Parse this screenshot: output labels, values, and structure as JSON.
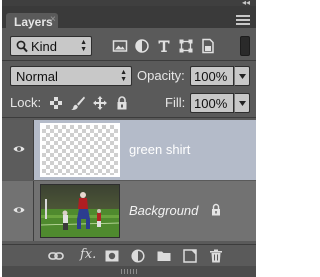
{
  "panel": {
    "tab_label": "Layers",
    "tab_close": "×",
    "collapse_glyph": "◂◂"
  },
  "filter": {
    "kind_label": "Kind",
    "icons": [
      "image-filter-icon",
      "adjustment-filter-icon",
      "type-filter-icon",
      "shape-filter-icon",
      "smart-object-filter-icon"
    ]
  },
  "blend": {
    "mode": "Normal",
    "opacity_label": "Opacity:",
    "opacity_value": "100%"
  },
  "lock": {
    "label": "Lock:",
    "fill_label": "Fill:",
    "fill_value": "100%"
  },
  "layers": [
    {
      "name": "green shirt",
      "visible": true,
      "selected": true,
      "transparent": true
    },
    {
      "name": "Background",
      "visible": true,
      "selected": false,
      "locked": true
    }
  ],
  "bottom_bar": {
    "fx_label": "fx."
  },
  "colors": {
    "panel_bg": "#5a5a5a",
    "selected_layer": "#b4bbc9",
    "field_bg": "#c8c8c8"
  }
}
